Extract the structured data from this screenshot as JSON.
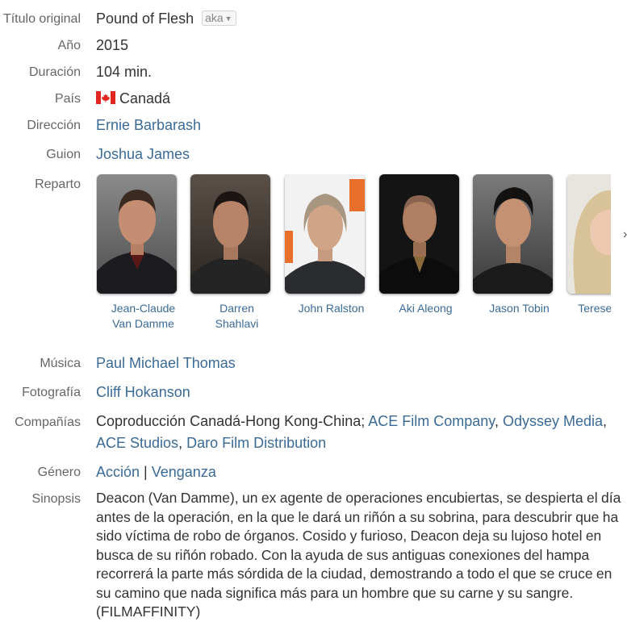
{
  "labels": {
    "titulo": "Título original",
    "anio": "Año",
    "duracion": "Duración",
    "pais": "País",
    "direccion": "Dirección",
    "guion": "Guion",
    "reparto": "Reparto",
    "musica": "Música",
    "fotografia": "Fotografía",
    "companias": "Compañías",
    "genero": "Género",
    "sinopsis": "Sinopsis"
  },
  "movie": {
    "title": "Pound of Flesh",
    "aka_label": "aka",
    "year": "2015",
    "duration": "104 min.",
    "country": "Canadá",
    "country_flag_icon": "canada-flag-icon",
    "director": "Ernie Barbarash",
    "writer": "Joshua James",
    "music": "Paul Michael Thomas",
    "photography": "Cliff Hokanson",
    "companies_text": "Coproducción Canadá-Hong Kong-China",
    "companies": [
      "ACE Film Company",
      "Odyssey Media",
      "ACE Studios",
      "Daro Film Distribution"
    ],
    "genres": [
      "Acción",
      "Venganza"
    ],
    "genre_separator": "|",
    "synopsis": "Deacon (Van Damme), un ex agente de operaciones encubiertas, se despierta el día antes de la operación, en la que le dará un riñón a su sobrina, para descubrir que ha sido víctima de robo de órganos. Cosido y furioso, Deacon deja su lujoso hotel en busca de su riñón robado. Con la ayuda de sus antiguas conexiones del hampa recorrerá la parte más sórdida de la ciudad, demostrando a todo el que se cruce en su camino que nada significa más para un hombre que su carne y su sangre. (FILMAFFINITY)"
  },
  "cast": [
    {
      "line1": "Jean-Claude",
      "line2": "Van Damme"
    },
    {
      "line1": "Darren",
      "line2": "Shahlavi"
    },
    {
      "line1": "John Ralston",
      "line2": ""
    },
    {
      "line1": "Aki Aleong",
      "line2": ""
    },
    {
      "line1": "Jason Tobin",
      "line2": ""
    },
    {
      "line1": "Terese Cilluffo",
      "line2": ""
    }
  ],
  "colors": {
    "label": "#666666",
    "text": "#333333",
    "link": "#3a6a96"
  }
}
